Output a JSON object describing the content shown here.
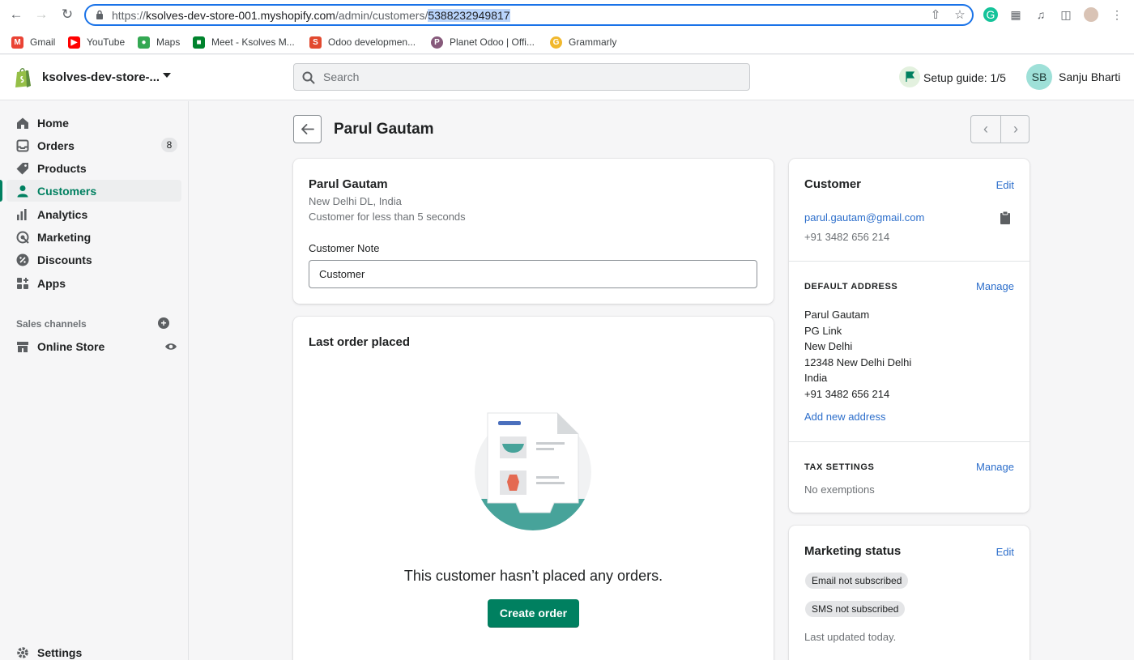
{
  "browser": {
    "url_prefix": "https://",
    "url_host": "ksolves-dev-store-001.myshopify.com",
    "url_path": "/admin/customers/",
    "url_selected": "5388232949817",
    "bookmarks": [
      {
        "label": "Gmail",
        "icon": "gmail-icon",
        "color": "#ea4335"
      },
      {
        "label": "YouTube",
        "icon": "youtube-icon",
        "color": "#ff0000"
      },
      {
        "label": "Maps",
        "icon": "maps-icon",
        "color": "#34a853"
      },
      {
        "label": "Meet - Ksolves M...",
        "icon": "meet-icon",
        "color": "#00832d"
      },
      {
        "label": "Odoo developmen...",
        "icon": "odoo-icon",
        "color": "#e2492f"
      },
      {
        "label": "Planet Odoo | Offi...",
        "icon": "planet-odoo-icon",
        "color": "#875a7b"
      },
      {
        "label": "Grammarly",
        "icon": "grammarly-icon",
        "color": "#15c39a"
      }
    ]
  },
  "topbar": {
    "store_name": "ksolves-dev-store-...",
    "search_placeholder": "Search",
    "setup_guide": "Setup guide: 1/5",
    "avatar_initials": "SB",
    "user_name": "Sanju Bharti"
  },
  "sidebar": {
    "items": [
      {
        "label": "Home",
        "icon": "home-icon"
      },
      {
        "label": "Orders",
        "icon": "orders-icon",
        "badge": "8"
      },
      {
        "label": "Products",
        "icon": "tag-icon"
      },
      {
        "label": "Customers",
        "icon": "person-icon",
        "active": true
      },
      {
        "label": "Analytics",
        "icon": "bar-chart-icon"
      },
      {
        "label": "Marketing",
        "icon": "target-icon"
      },
      {
        "label": "Discounts",
        "icon": "discount-icon"
      },
      {
        "label": "Apps",
        "icon": "apps-icon"
      }
    ],
    "sales_channels_label": "Sales channels",
    "online_store": "Online Store",
    "settings": "Settings"
  },
  "page": {
    "title": "Parul Gautam"
  },
  "customer_card": {
    "name": "Parul Gautam",
    "location": "New Delhi DL, India",
    "since": "Customer for less than 5 seconds",
    "note_label": "Customer Note",
    "note_value": "Customer"
  },
  "last_order": {
    "heading": "Last order placed",
    "empty_message": "This customer hasn’t placed any orders.",
    "button": "Create order"
  },
  "customer_panel": {
    "heading": "Customer",
    "edit": "Edit",
    "email": "parul.gautam@gmail.com",
    "phone": "+91 3482 656 214",
    "default_address_label": "DEFAULT ADDRESS",
    "manage": "Manage",
    "address_lines": [
      "Parul Gautam",
      "PG Link",
      "New Delhi",
      "12348 New Delhi Delhi",
      "India",
      "+91 3482 656 214"
    ],
    "add_address": "Add new address",
    "tax_label": "TAX SETTINGS",
    "tax_manage": "Manage",
    "tax_value": "No exemptions"
  },
  "marketing": {
    "heading": "Marketing status",
    "edit": "Edit",
    "email_status": "Email not subscribed",
    "sms_status": "SMS not subscribed",
    "updated": "Last updated today."
  },
  "colors": {
    "accent": "#008060",
    "link": "#2c6ecb",
    "browser_focus": "#1a73e8"
  }
}
